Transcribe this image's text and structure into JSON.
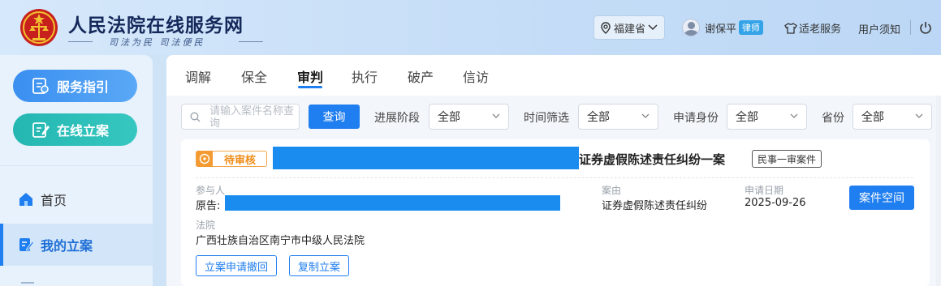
{
  "header": {
    "site_title": "人民法院在线服务网",
    "slogan": "司法为民  司法便民",
    "region": "福建省",
    "user_name": "谢保平",
    "user_role": "律师",
    "elder_service": "适老服务",
    "user_notice": "用户须知"
  },
  "sidebar": {
    "guide_button": "服务指引",
    "file_button": "在线立案",
    "nav": [
      {
        "label": "首页",
        "icon": "home-icon"
      },
      {
        "label": "我的立案",
        "icon": "edit-icon",
        "active": true
      }
    ]
  },
  "tabs": [
    "调解",
    "保全",
    "审判",
    "执行",
    "破产",
    "信访"
  ],
  "active_tab": "审判",
  "filters": {
    "search_placeholder": "请输入案件名称查询",
    "query_button": "查询",
    "progress_label": "进展阶段",
    "progress_value": "全部",
    "time_label": "时间筛选",
    "time_value": "全部",
    "identity_label": "申请身份",
    "identity_value": "全部",
    "province_label": "省份",
    "province_value": "全部"
  },
  "case": {
    "status": "待审核",
    "title_suffix": "证券虚假陈述责任纠纷一案",
    "case_type": "民事一审案件",
    "participants_label": "参与人",
    "plaintiff_prefix": "原告:",
    "cause_label": "案由",
    "cause_value": "证券虚假陈述责任纠纷",
    "date_label": "申请日期",
    "date_value": "2025-09-26",
    "court_label": "法院",
    "court_value": "广西壮族自治区南宁市中级人民法院",
    "space_button": "案件空间",
    "withdraw_button": "立案申请撤回",
    "copy_button": "复制立案"
  },
  "colors": {
    "primary": "#1f7ef0",
    "pending": "#f08c17",
    "teal": "#24b6b1",
    "redaction": "#1a8cf0"
  }
}
